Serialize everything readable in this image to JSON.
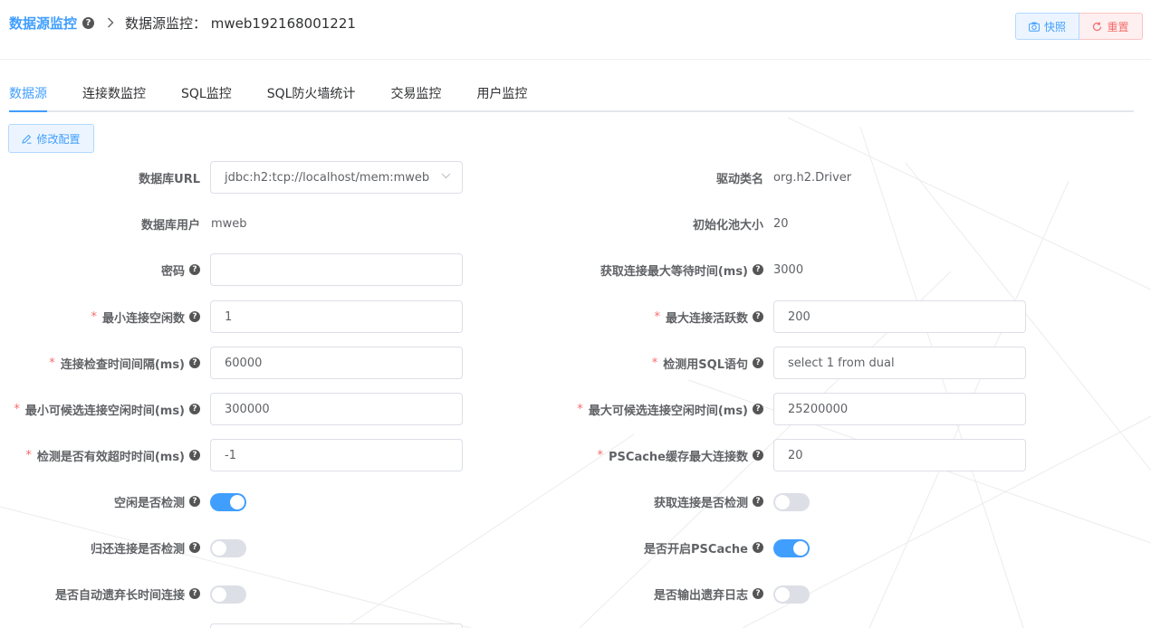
{
  "header": {
    "title": "数据源监控",
    "subtitle": "数据源监控： mweb192168001221",
    "snapshot_label": "快照",
    "reset_label": "重置"
  },
  "tabs": [
    {
      "label": "数据源",
      "active": true
    },
    {
      "label": "连接数监控",
      "active": false
    },
    {
      "label": "SQL监控",
      "active": false
    },
    {
      "label": "SQL防火墙统计",
      "active": false
    },
    {
      "label": "交易监控",
      "active": false
    },
    {
      "label": "用户监控",
      "active": false
    }
  ],
  "edit_button": "修改配置",
  "form": {
    "db_url": {
      "label": "数据库URL",
      "value": "jdbc:h2:tcp://localhost/mem:mweb"
    },
    "driver": {
      "label": "驱动类名",
      "value": "org.h2.Driver"
    },
    "db_user": {
      "label": "数据库用户",
      "value": "mweb"
    },
    "init_pool": {
      "label": "初始化池大小",
      "value": "20"
    },
    "password": {
      "label": "密码",
      "value": ""
    },
    "max_wait": {
      "label": "获取连接最大等待时间(ms)",
      "value": "3000"
    },
    "min_idle": {
      "label": "最小连接空闲数",
      "value": "1"
    },
    "max_active": {
      "label": "最大连接活跃数",
      "value": "200"
    },
    "check_interval": {
      "label": "连接检查时间间隔(ms)",
      "value": "60000"
    },
    "validation_sql": {
      "label": "检测用SQL语句",
      "value": "select 1 from dual"
    },
    "min_evict": {
      "label": "最小可候选连接空闲时间(ms)",
      "value": "300000"
    },
    "max_evict": {
      "label": "最大可候选连接空闲时间(ms)",
      "value": "25200000"
    },
    "validation_timeout": {
      "label": "检测是否有效超时时间(ms)",
      "value": "-1"
    },
    "pscache_max": {
      "label": "PSCache缓存最大连接数",
      "value": "20"
    },
    "test_idle": {
      "label": "空闲是否检测",
      "on": true
    },
    "test_borrow": {
      "label": "获取连接是否检测",
      "on": false
    },
    "test_return": {
      "label": "归还连接是否检测",
      "on": false
    },
    "pscache_enable": {
      "label": "是否开启PSCache",
      "on": true
    },
    "remove_abandoned": {
      "label": "是否自动遗弃长时间连接",
      "on": false
    },
    "log_abandoned": {
      "label": "是否输出遗弃日志",
      "on": false
    }
  },
  "colors": {
    "primary": "#409EFF",
    "danger": "#F56C6C",
    "required": "#F56C6C"
  }
}
